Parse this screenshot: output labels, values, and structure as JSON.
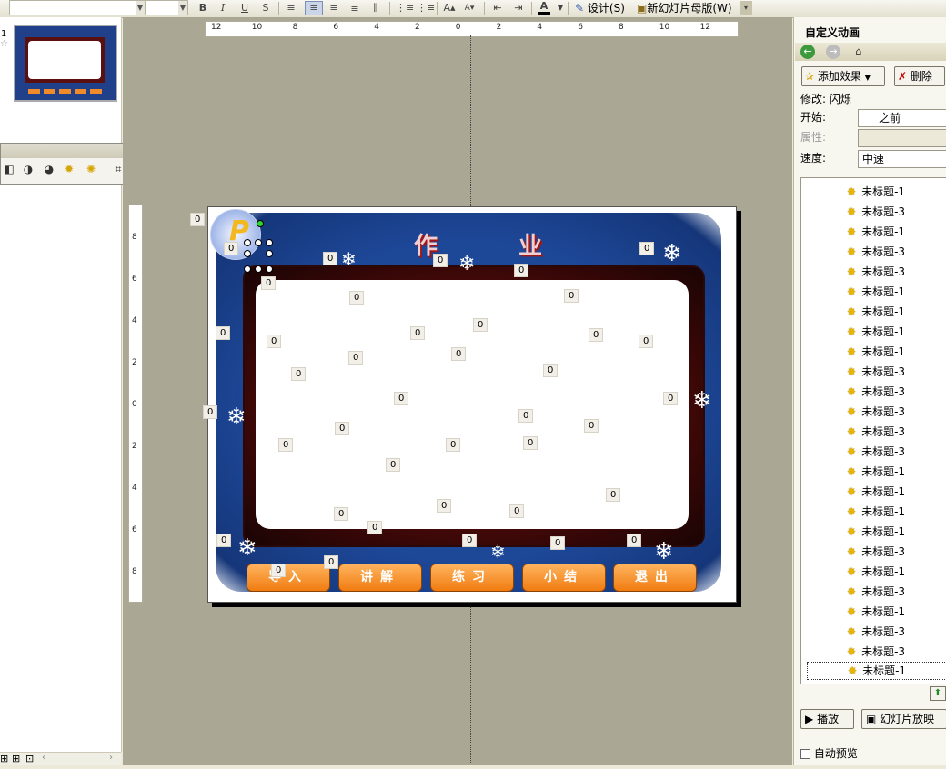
{
  "toolbar": {
    "font_size_value": "",
    "bold": "B",
    "italic": "I",
    "underline": "U",
    "shadow": "S",
    "font_color_letter": "A",
    "design_label": "设计(S)",
    "new_master_label": "新幻灯片母版(W)"
  },
  "thumbnails": {
    "slide_number": "1"
  },
  "rulers": {
    "horizontal": [
      "12",
      "10",
      "8",
      "6",
      "4",
      "2",
      "0",
      "2",
      "4",
      "6",
      "8",
      "10",
      "12"
    ],
    "vertical": [
      "8",
      "6",
      "4",
      "2",
      "0",
      "2",
      "4",
      "6",
      "8"
    ]
  },
  "slide": {
    "title": "作 业",
    "logo_letter": "P",
    "buttons": [
      "导入",
      "讲解",
      "练习",
      "小结",
      "退出"
    ],
    "markers_label": "0"
  },
  "task_pane": {
    "title": "自定义动画",
    "add_effect": "添加效果",
    "delete": "删除",
    "modify_label": "修改: 闪烁",
    "start_label": "开始:",
    "start_value": "之前",
    "property_label": "属性:",
    "speed_label": "速度:",
    "speed_value": "中速",
    "items": [
      "未标题-1",
      "未标题-3",
      "未标题-1",
      "未标题-3",
      "未标题-3",
      "未标题-1",
      "未标题-1",
      "未标题-1",
      "未标题-1",
      "未标题-3",
      "未标题-3",
      "未标题-3",
      "未标题-3",
      "未标题-3",
      "未标题-1",
      "未标题-1",
      "未标题-1",
      "未标题-1",
      "未标题-3",
      "未标题-1",
      "未标题-3",
      "未标题-1",
      "未标题-3",
      "未标题-3",
      "未标题-1"
    ],
    "play": "播放",
    "slideshow": "幻灯片放映",
    "autopreview": "自动预览"
  },
  "colors": {
    "slide_blue": "#1d4797",
    "button_orange": "#f07c10",
    "editor_bg": "#aaa795"
  }
}
